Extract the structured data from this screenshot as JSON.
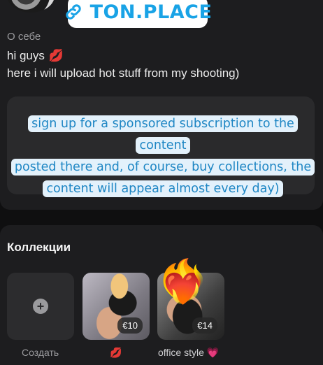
{
  "badge": {
    "label": "TON.PLACE",
    "icon": "link-icon"
  },
  "about": {
    "label": "О себе",
    "line1": "hi guys",
    "line1_emoji": "💋",
    "line2": "here i will upload hot stuff from my shooting)"
  },
  "sponsor": {
    "line1": "sign up for a sponsored subscription to the content",
    "line2": "posted there and, of course, buy collections, the",
    "line3": "content will appear almost every day)"
  },
  "collections": {
    "title": "Коллекции",
    "create_label": "Создать",
    "items": [
      {
        "price": "€10",
        "caption": "💋"
      },
      {
        "price": "€14",
        "caption": "office style 💗",
        "overlay_emoji": "❤️‍🔥"
      }
    ]
  },
  "colors": {
    "accent": "#19a3e6",
    "card": "#1d1d1f",
    "background": "#0f0f10"
  }
}
